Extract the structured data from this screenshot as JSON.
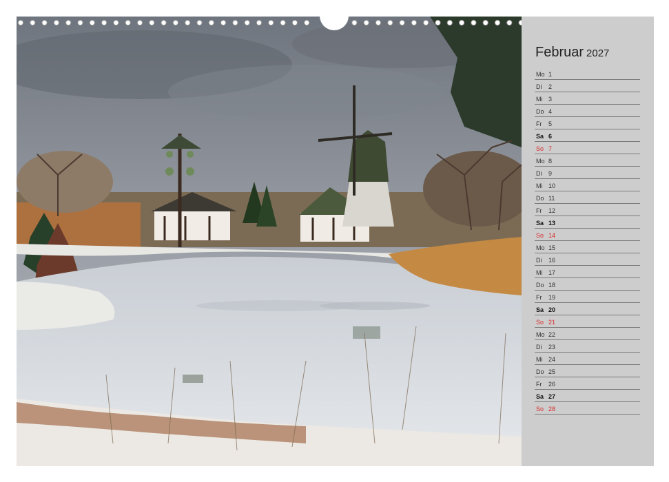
{
  "calendar": {
    "month": "Februar",
    "year": "2027",
    "accent_sunday": "#d82b2b",
    "days": [
      {
        "wd": "Mo",
        "d": "1",
        "type": "weekday"
      },
      {
        "wd": "Di",
        "d": "2",
        "type": "weekday"
      },
      {
        "wd": "Mi",
        "d": "3",
        "type": "weekday"
      },
      {
        "wd": "Do",
        "d": "4",
        "type": "weekday"
      },
      {
        "wd": "Fr",
        "d": "5",
        "type": "weekday"
      },
      {
        "wd": "Sa",
        "d": "6",
        "type": "sat"
      },
      {
        "wd": "So",
        "d": "7",
        "type": "sun"
      },
      {
        "wd": "Mo",
        "d": "8",
        "type": "weekday"
      },
      {
        "wd": "Di",
        "d": "9",
        "type": "weekday"
      },
      {
        "wd": "Mi",
        "d": "10",
        "type": "weekday"
      },
      {
        "wd": "Do",
        "d": "11",
        "type": "weekday"
      },
      {
        "wd": "Fr",
        "d": "12",
        "type": "weekday"
      },
      {
        "wd": "Sa",
        "d": "13",
        "type": "sat"
      },
      {
        "wd": "So",
        "d": "14",
        "type": "sun"
      },
      {
        "wd": "Mo",
        "d": "15",
        "type": "weekday"
      },
      {
        "wd": "Di",
        "d": "16",
        "type": "weekday"
      },
      {
        "wd": "Mi",
        "d": "17",
        "type": "weekday"
      },
      {
        "wd": "Do",
        "d": "18",
        "type": "weekday"
      },
      {
        "wd": "Fr",
        "d": "19",
        "type": "weekday"
      },
      {
        "wd": "Sa",
        "d": "20",
        "type": "sat"
      },
      {
        "wd": "So",
        "d": "21",
        "type": "sun"
      },
      {
        "wd": "Mo",
        "d": "22",
        "type": "weekday"
      },
      {
        "wd": "Di",
        "d": "23",
        "type": "weekday"
      },
      {
        "wd": "Mi",
        "d": "24",
        "type": "weekday"
      },
      {
        "wd": "Do",
        "d": "25",
        "type": "weekday"
      },
      {
        "wd": "Fr",
        "d": "26",
        "type": "weekday"
      },
      {
        "wd": "Sa",
        "d": "27",
        "type": "sat"
      },
      {
        "wd": "So",
        "d": "28",
        "type": "sun"
      }
    ]
  }
}
